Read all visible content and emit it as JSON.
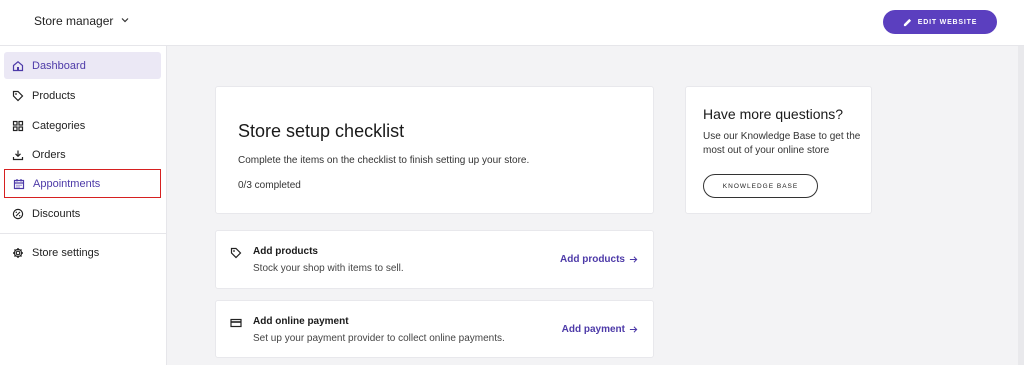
{
  "header": {
    "store_switcher_label": "Store manager",
    "edit_button_label": "EDIT WEBSITE"
  },
  "sidebar": {
    "items": [
      {
        "label": "Dashboard",
        "icon": "home-icon"
      },
      {
        "label": "Products",
        "icon": "tag-icon"
      },
      {
        "label": "Categories",
        "icon": "grid-icon"
      },
      {
        "label": "Orders",
        "icon": "download-tray-icon"
      },
      {
        "label": "Appointments",
        "icon": "calendar-icon"
      },
      {
        "label": "Discounts",
        "icon": "discount-badge-icon"
      },
      {
        "label": "Store settings",
        "icon": "gear-icon"
      }
    ]
  },
  "checklist": {
    "title": "Store setup checklist",
    "description": "Complete the items on the checklist to finish setting up your store.",
    "progress": "0/3 completed"
  },
  "tasks": [
    {
      "title": "Add products",
      "description": "Stock your shop with items to sell.",
      "link": "Add products",
      "icon": "tag-icon"
    },
    {
      "title": "Add online payment",
      "description": "Set up your payment provider to collect online payments.",
      "link": "Add payment",
      "icon": "credit-card-icon"
    }
  ],
  "help": {
    "title": "Have more questions?",
    "description": "Use our Knowledge Base to get the most out of your online store",
    "button_label": "KNOWLEDGE BASE"
  },
  "colors": {
    "accent": "#5b3fbf",
    "active_bg": "#ebe8f5",
    "highlight_border": "#d62020"
  }
}
